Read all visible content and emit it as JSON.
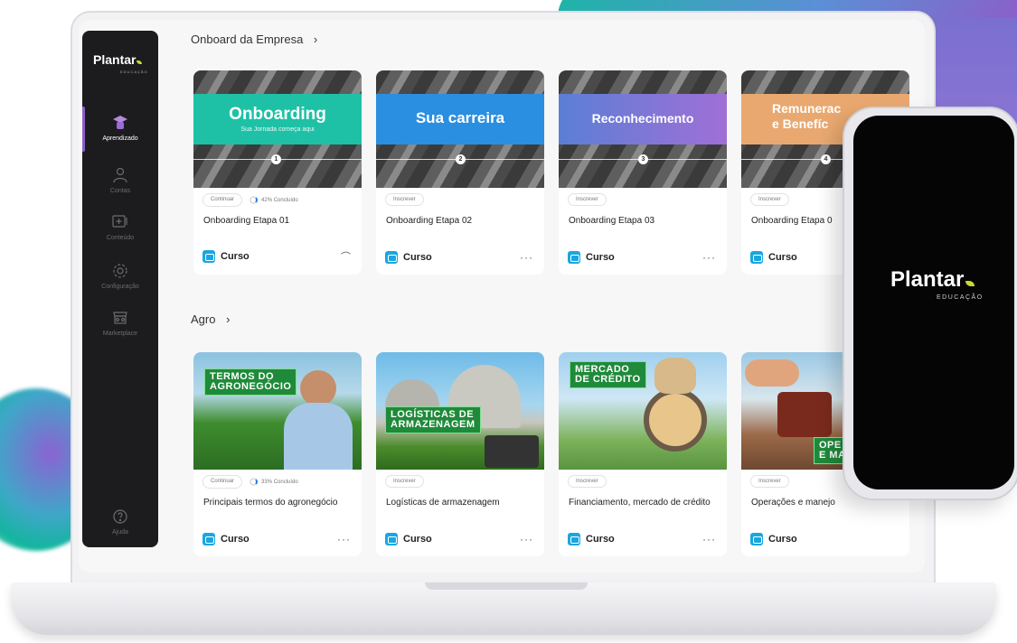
{
  "brand": {
    "name": "Plantar",
    "subtitle": "EDUCAÇÃO",
    "accent": "#8b5fc7",
    "leaf_color": "#c7d83a"
  },
  "sidebar": {
    "items": [
      {
        "label": "Aprendizado",
        "icon": "graduate-icon",
        "active": true
      },
      {
        "label": "Contas",
        "icon": "user-icon",
        "active": false
      },
      {
        "label": "Conteúdo",
        "icon": "content-icon",
        "active": false
      },
      {
        "label": "Configuração",
        "icon": "gear-icon",
        "active": false
      },
      {
        "label": "Marketplace",
        "icon": "store-icon",
        "active": false
      }
    ],
    "help": {
      "label": "Ajuda",
      "icon": "help-icon"
    }
  },
  "sections": [
    {
      "title": "Onboard da Empresa",
      "cards": [
        {
          "banner": "Onboarding",
          "banner_sub": "Sua Jornada começa aqui",
          "step": "1",
          "chip": "Continuar",
          "progress": "42% Concluído",
          "title": "Onboarding Etapa 01",
          "type": "Curso",
          "action": "link"
        },
        {
          "banner": "Sua carreira",
          "step": "2",
          "chip": "Inscrever",
          "title": "Onboarding Etapa 02",
          "type": "Curso",
          "action": "more"
        },
        {
          "banner": "Reconhecimento",
          "step": "3",
          "chip": "Inscrever",
          "title": "Onboarding Etapa 03",
          "type": "Curso",
          "action": "more"
        },
        {
          "banner_line1": "Remunerac",
          "banner_line2": "e Benefíc",
          "step": "4",
          "chip": "Inscrever",
          "title": "Onboarding Etapa 0",
          "type": "Curso",
          "action": "more"
        }
      ]
    },
    {
      "title": "Agro",
      "cards": [
        {
          "tag_line1": "TERMOS DO",
          "tag_line2": "AGRONEGÓCIO",
          "chip": "Continuar",
          "progress": "33% Concluído",
          "title": "Principais termos do agronegócio",
          "type": "Curso",
          "action": "more"
        },
        {
          "tag_line1": "LOGÍSTICAS DE",
          "tag_line2": "ARMAZENAGEM",
          "chip": "Inscrever",
          "title": "Logísticas de armazenagem",
          "type": "Curso",
          "action": "more"
        },
        {
          "tag_line1": "MERCADO",
          "tag_line2": "DE CRÉDITO",
          "chip": "Inscrever",
          "title": "Financiamento, mercado de crédito",
          "type": "Curso",
          "action": "more"
        },
        {
          "tag_line1": "OPE",
          "tag_line2": "E MA",
          "chip": "Inscrever",
          "title": "Operações e manejo",
          "type": "Curso",
          "action": "more"
        }
      ]
    }
  ],
  "phone": {
    "brand": "Plantar",
    "subtitle": "EDUCAÇÃO"
  }
}
